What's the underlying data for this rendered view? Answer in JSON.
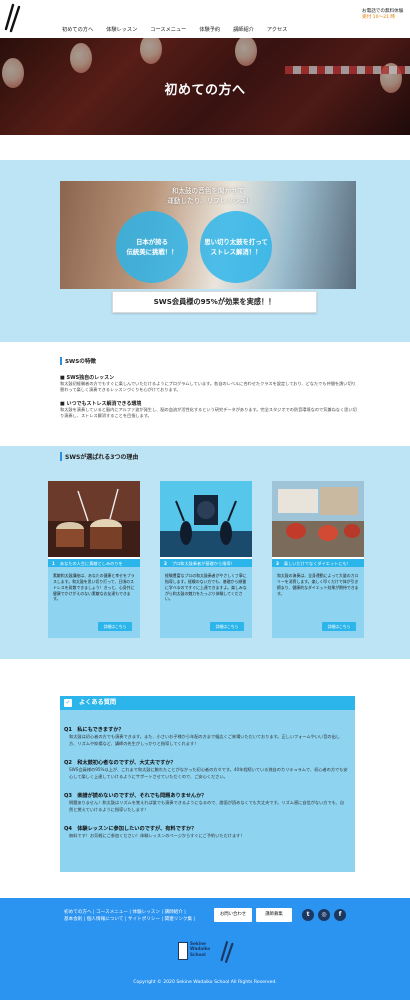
{
  "header": {
    "nav": [
      "初めての方へ",
      "体験レッスン",
      "コースメニュー",
      "体験予約",
      "講師紹介",
      "アクセス"
    ],
    "contact_line1": "お電話での無料体験",
    "contact_line2": "受付 10〜21 時"
  },
  "hero": {
    "title": "初めての方へ"
  },
  "promo": {
    "heading_line1": "和太鼓の音色を聞かせて",
    "heading_line2": "運動したり、リフレッシュ!",
    "bubble_left_line1": "日本が誇る",
    "bubble_left_line2": "伝統美に挑戦！！",
    "bubble_right_line1": "思い切り太鼓を打って",
    "bubble_right_line2": "ストレス解消！！",
    "tagline": "SWS会員様の95%が効果を実感！！"
  },
  "features": {
    "title": "SWSの特徴",
    "items": [
      {
        "heading": "■ SWS独自のレッスン",
        "body": "和太鼓初経験者の方でもすぐに楽しんでいただけるようにプログラムしています。各自のレベルに合わせたクラスを設定しており、どなたでも仲間を誘い切り替わって楽しく演奏できるレッスンづくりを心がけております。"
      },
      {
        "heading": "■ いつでもストレス解消できる環境",
        "body": "和太鼓を演奏していると脳内にアルファ波が発生し、脳の血流が活性化するという研究データがあります。完全スタジオでの防音環境なので気兼ねなく思い切り演奏し、ストレス解消することを目指します。"
      }
    ]
  },
  "reasons": {
    "title": "SWSが選ばれる3つの理由",
    "button_label": "詳細はこちら",
    "cards": [
      {
        "num": "1",
        "label": "あなたの人生に素敵としみのりを",
        "text": "素敵和太鼓講座は、あなたの健康と幸せをプラスします。和太鼓を思い切り打って、日頃のストレスを発散できましょう！きっと、心身共に健康でかけがえのない素敵なお友達もできます。"
      },
      {
        "num": "2",
        "label": "プロ和太鼓奏者が基礎から指導！",
        "text": "経験豊富なプロの和太鼓奏者がやさしく丁寧に指導します。経験のない方でも、基礎から順番に学べるのですぐに上達できますよ。楽しみながら和太鼓の魅力をたっぷり体験してください。"
      },
      {
        "num": "3",
        "label": "楽しいだけでなくダイエットにも！",
        "text": "和太鼓の演奏は、全身運動によって大量のカロリーを消費します。楽しく叩くだけで体が引き締まり、健康的なダイエット効果が期待できます。"
      }
    ]
  },
  "faq": {
    "title": "よくある質問",
    "items": [
      {
        "q": "Q1　私にもできますか？",
        "a": "和太鼓は初心者の方でも演奏できます。また、小さいお子様から年配の方まで幅広くご来場いただいております。正しいフォームやいい音の出し方、リズムや抑揚など、講師の先生がしっかりと指導してくれます！"
      },
      {
        "q": "Q2　和太鼓初心者なのですが、大丈夫ですか？",
        "a": "SWS会員様の95%以上が、これまで和太鼓に触れたことがなかった初心者の方々です。40年程続いている独自のカリキュラムで、初心者の方でも安心して楽しく上達していけるようにサポートさせていただくので、ご安心ください。"
      },
      {
        "q": "Q3　楽譜が読めないのですが、それでも問題ありませんか？",
        "a": "問題ありません！和太鼓はリズムを覚えれば誰でも演奏できるようになるので、譜面が読めなくても大丈夫です。リズム感に自信がない方でも、自然と覚えていけるように指導いたします！"
      },
      {
        "q": "Q4　体験レッスンに参加したいのですが、有料ですか？",
        "a": "無料です！お気軽にご参加ください！体験レッスンのページからすぐにご予約いただけます！"
      }
    ]
  },
  "footer": {
    "links_line1": "初めての方へ | コースメニュー | 体験レッスン | 講師紹介 |",
    "links_line2": "基本会則 | 個人情報について | サイトポリシー | 関連リンク集 |",
    "button_contact": "お問い合わせ",
    "button_recruit": "講師募集",
    "social": [
      "twitter-icon",
      "instagram-icon",
      "facebook-icon"
    ],
    "logo_text_line1": "Sekine",
    "logo_text_line2": "Wadaiko",
    "logo_text_line3": "School",
    "copyright": "Copyright © 2020 Sekine Wadaiko School All Rights Reserved."
  },
  "colors": {
    "accent": "#2bb5ea",
    "band": "#bde4f5",
    "panel": "#8ed3f0",
    "footer": "#2b93f0",
    "contact_hours": "#e27a00"
  }
}
